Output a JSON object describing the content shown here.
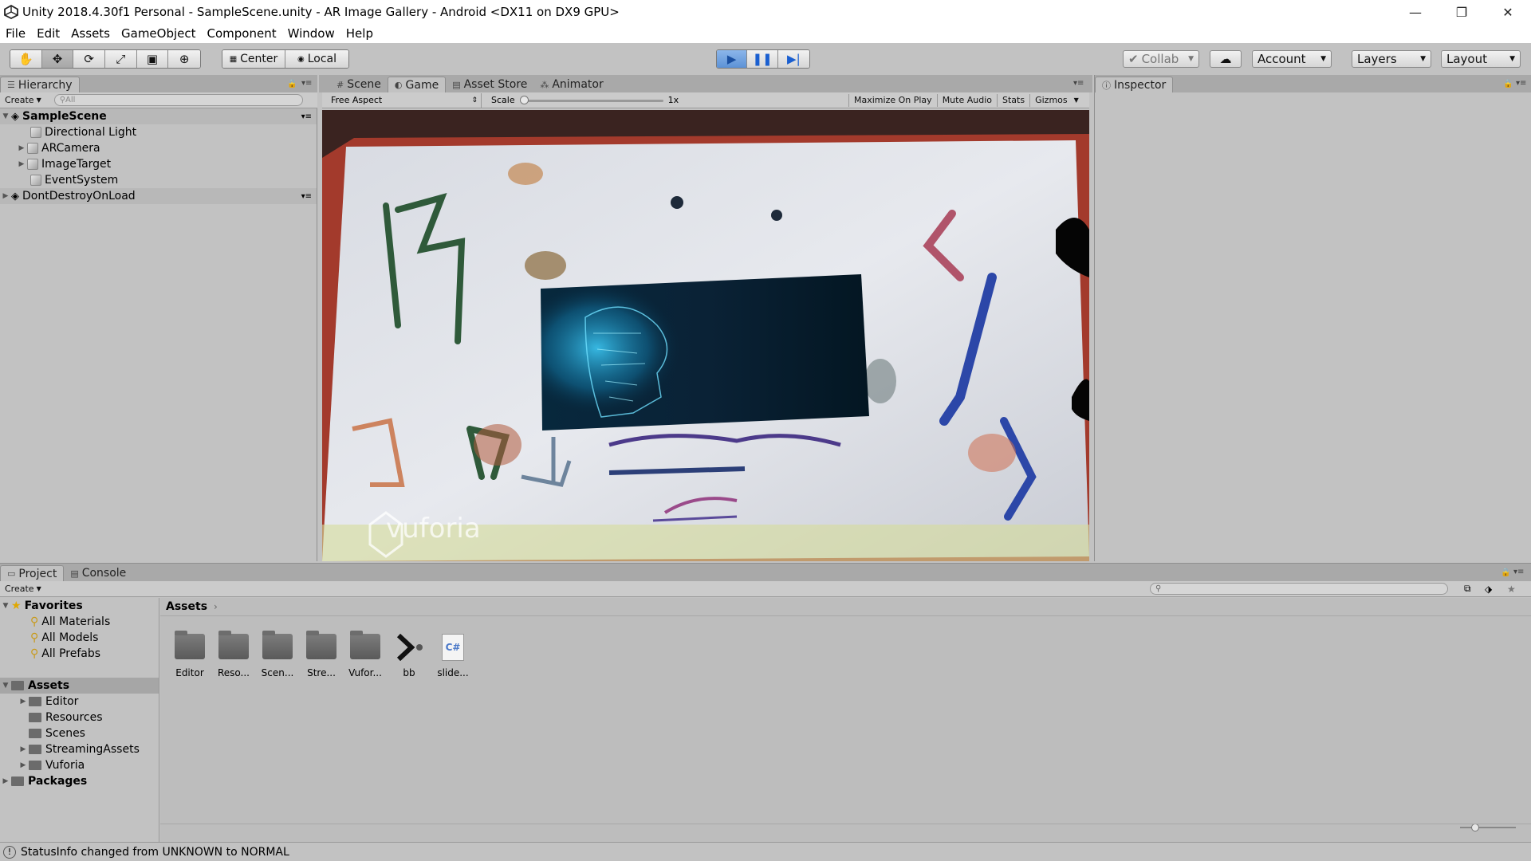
{
  "window": {
    "title": "Unity 2018.4.30f1 Personal - SampleScene.unity - AR Image Gallery - Android <DX11 on DX9 GPU>",
    "minimize_glyph": "—",
    "restore_glyph": "❐",
    "close_glyph": "✕"
  },
  "menu": [
    "File",
    "Edit",
    "Assets",
    "GameObject",
    "Component",
    "Window",
    "Help"
  ],
  "toolbar": {
    "pivot_label": "Center",
    "space_label": "Local",
    "collab_label": "Collab",
    "account_label": "Account",
    "layers_label": "Layers",
    "layout_label": "Layout"
  },
  "hierarchy": {
    "tab_label": "Hierarchy",
    "create_label": "Create",
    "search_placeholder": "All",
    "scenes": [
      {
        "name": "SampleScene",
        "children": [
          "Directional Light",
          "ARCamera",
          "ImageTarget",
          "EventSystem"
        ]
      },
      {
        "name": "DontDestroyOnLoad"
      }
    ]
  },
  "center_tabs": [
    "Scene",
    "Game",
    "Asset Store",
    "Animator"
  ],
  "game_bar": {
    "aspect": "Free Aspect",
    "scale_label": "Scale",
    "scale_value": "1x",
    "maximize": "Maximize On Play",
    "mute": "Mute Audio",
    "stats": "Stats",
    "gizmos": "Gizmos"
  },
  "game_view": {
    "watermark": "vuforia"
  },
  "inspector": {
    "tab_label": "Inspector"
  },
  "project": {
    "tab_project": "Project",
    "tab_console": "Console",
    "create_label": "Create",
    "favorites_label": "Favorites",
    "favorites": [
      "All Materials",
      "All Models",
      "All Prefabs"
    ],
    "assets_label": "Assets",
    "asset_folders": [
      "Editor",
      "Resources",
      "Scenes",
      "StreamingAssets",
      "Vuforia"
    ],
    "packages_label": "Packages",
    "breadcrumb": "Assets",
    "tiles": [
      "Editor",
      "Reso...",
      "Scen...",
      "Stre...",
      "Vufor...",
      "bb",
      "slide..."
    ],
    "script_badge": "C#"
  },
  "status": {
    "text": "StatusInfo changed from UNKNOWN to NORMAL"
  },
  "colors": {
    "play_active": "#5d92d6",
    "panel_bg": "#c2c2c2",
    "tab_strip": "#a9a9a9"
  }
}
